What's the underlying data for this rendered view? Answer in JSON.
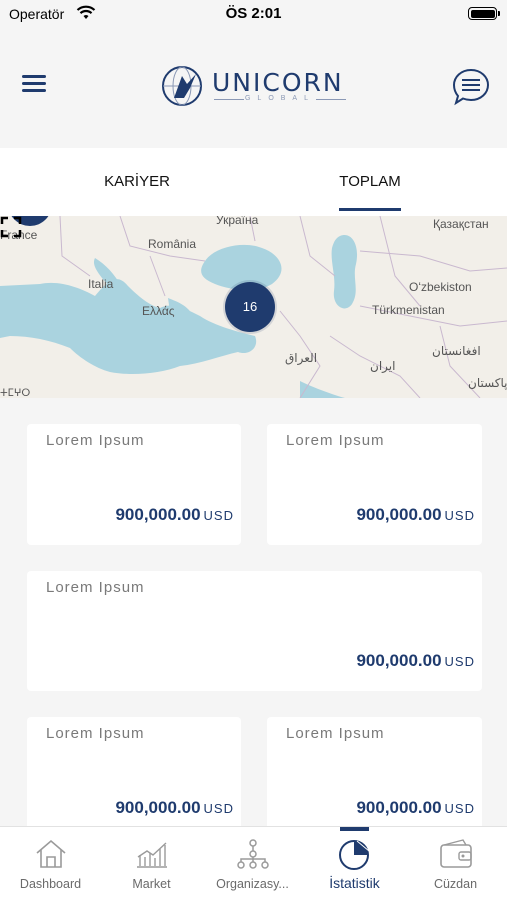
{
  "status_bar": {
    "carrier": "Operatör",
    "time": "ÖS 2:01"
  },
  "header": {
    "logo_text": "UNICORN",
    "logo_subtext": "GLOBAL"
  },
  "tabs": [
    {
      "label": "KARİYER",
      "active": false
    },
    {
      "label": "TOPLAM",
      "active": true
    }
  ],
  "map": {
    "cluster_count": "16",
    "labels": [
      "France",
      "Україна",
      "Қазақстан",
      "România",
      "Italia",
      "Ελλάς",
      "Oʻzbekiston",
      "Türkmenistan",
      "العراق",
      "ایران",
      "افغانستان",
      "پاکستان",
      "ⵜⵎⵖⵔ"
    ]
  },
  "cards": [
    {
      "title": "Lorem Ipsum",
      "amount": "900,000.00",
      "currency": "USD"
    },
    {
      "title": "Lorem Ipsum",
      "amount": "900,000.00",
      "currency": "USD"
    },
    {
      "title": "Lorem Ipsum",
      "amount": "900,000.00",
      "currency": "USD"
    },
    {
      "title": "Lorem Ipsum",
      "amount": "900,000.00",
      "currency": "USD"
    },
    {
      "title": "Lorem Ipsum",
      "amount": "900,000.00",
      "currency": "USD"
    }
  ],
  "bottom_nav": [
    {
      "label": "Dashboard",
      "icon": "home-icon"
    },
    {
      "label": "Market",
      "icon": "chart-icon"
    },
    {
      "label": "Organizasy...",
      "icon": "org-tree-icon"
    },
    {
      "label": "İstatistik",
      "icon": "pie-chart-icon",
      "active": true
    },
    {
      "label": "Cüzdan",
      "icon": "wallet-icon"
    }
  ],
  "colors": {
    "primary": "#1f3b6e",
    "background": "#f5f5f5",
    "card": "#ffffff",
    "sea": "#aad3df"
  }
}
